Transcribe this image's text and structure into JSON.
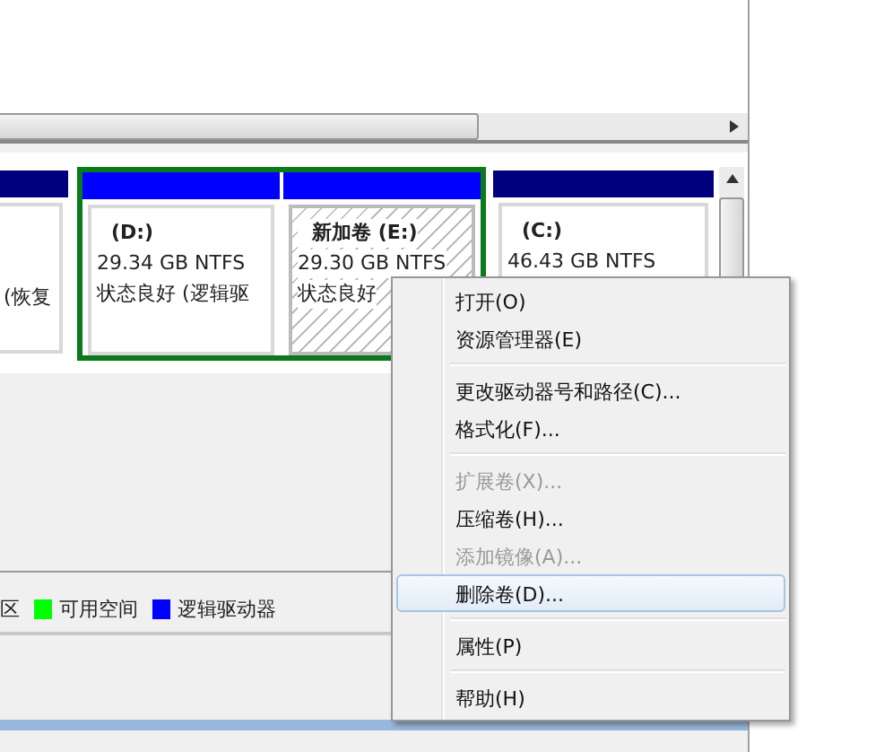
{
  "disk_map": {
    "volumes": [
      {
        "kind": "primary",
        "lines": [
          "(恢复"
        ]
      },
      {
        "kind": "extended",
        "children": [
          {
            "kind": "logical",
            "selected": false,
            "lines": [
              "(D:)",
              "29.34 GB NTFS",
              "状态良好 (逻辑驱"
            ]
          },
          {
            "kind": "logical",
            "selected": true,
            "lines": [
              "新加卷  (E:)",
              "29.30 GB NTFS",
              "状态良好"
            ]
          }
        ]
      },
      {
        "kind": "primary",
        "lines": [
          "(C:)",
          "46.43 GB NTFS"
        ]
      }
    ]
  },
  "legend": [
    {
      "label": "区"
    },
    {
      "label": "可用空间",
      "color": "#00ff00"
    },
    {
      "label": "逻辑驱动器",
      "color": "#0000ff"
    }
  ],
  "context_menu": [
    {
      "kind": "item",
      "label": "打开(O)",
      "disabled": false,
      "selected": false
    },
    {
      "kind": "item",
      "label": "资源管理器(E)",
      "disabled": false,
      "selected": false
    },
    {
      "kind": "separator"
    },
    {
      "kind": "item",
      "label": "更改驱动器号和路径(C)...",
      "disabled": false,
      "selected": false
    },
    {
      "kind": "item",
      "label": "格式化(F)...",
      "disabled": false,
      "selected": false
    },
    {
      "kind": "separator"
    },
    {
      "kind": "item",
      "label": "扩展卷(X)...",
      "disabled": true,
      "selected": false
    },
    {
      "kind": "item",
      "label": "压缩卷(H)...",
      "disabled": false,
      "selected": false
    },
    {
      "kind": "item",
      "label": "添加镜像(A)...",
      "disabled": true,
      "selected": false
    },
    {
      "kind": "item",
      "label": "删除卷(D)...",
      "disabled": false,
      "selected": true
    },
    {
      "kind": "separator"
    },
    {
      "kind": "item",
      "label": "属性(P)",
      "disabled": false,
      "selected": false
    },
    {
      "kind": "separator"
    },
    {
      "kind": "item",
      "label": "帮助(H)",
      "disabled": false,
      "selected": false
    }
  ]
}
